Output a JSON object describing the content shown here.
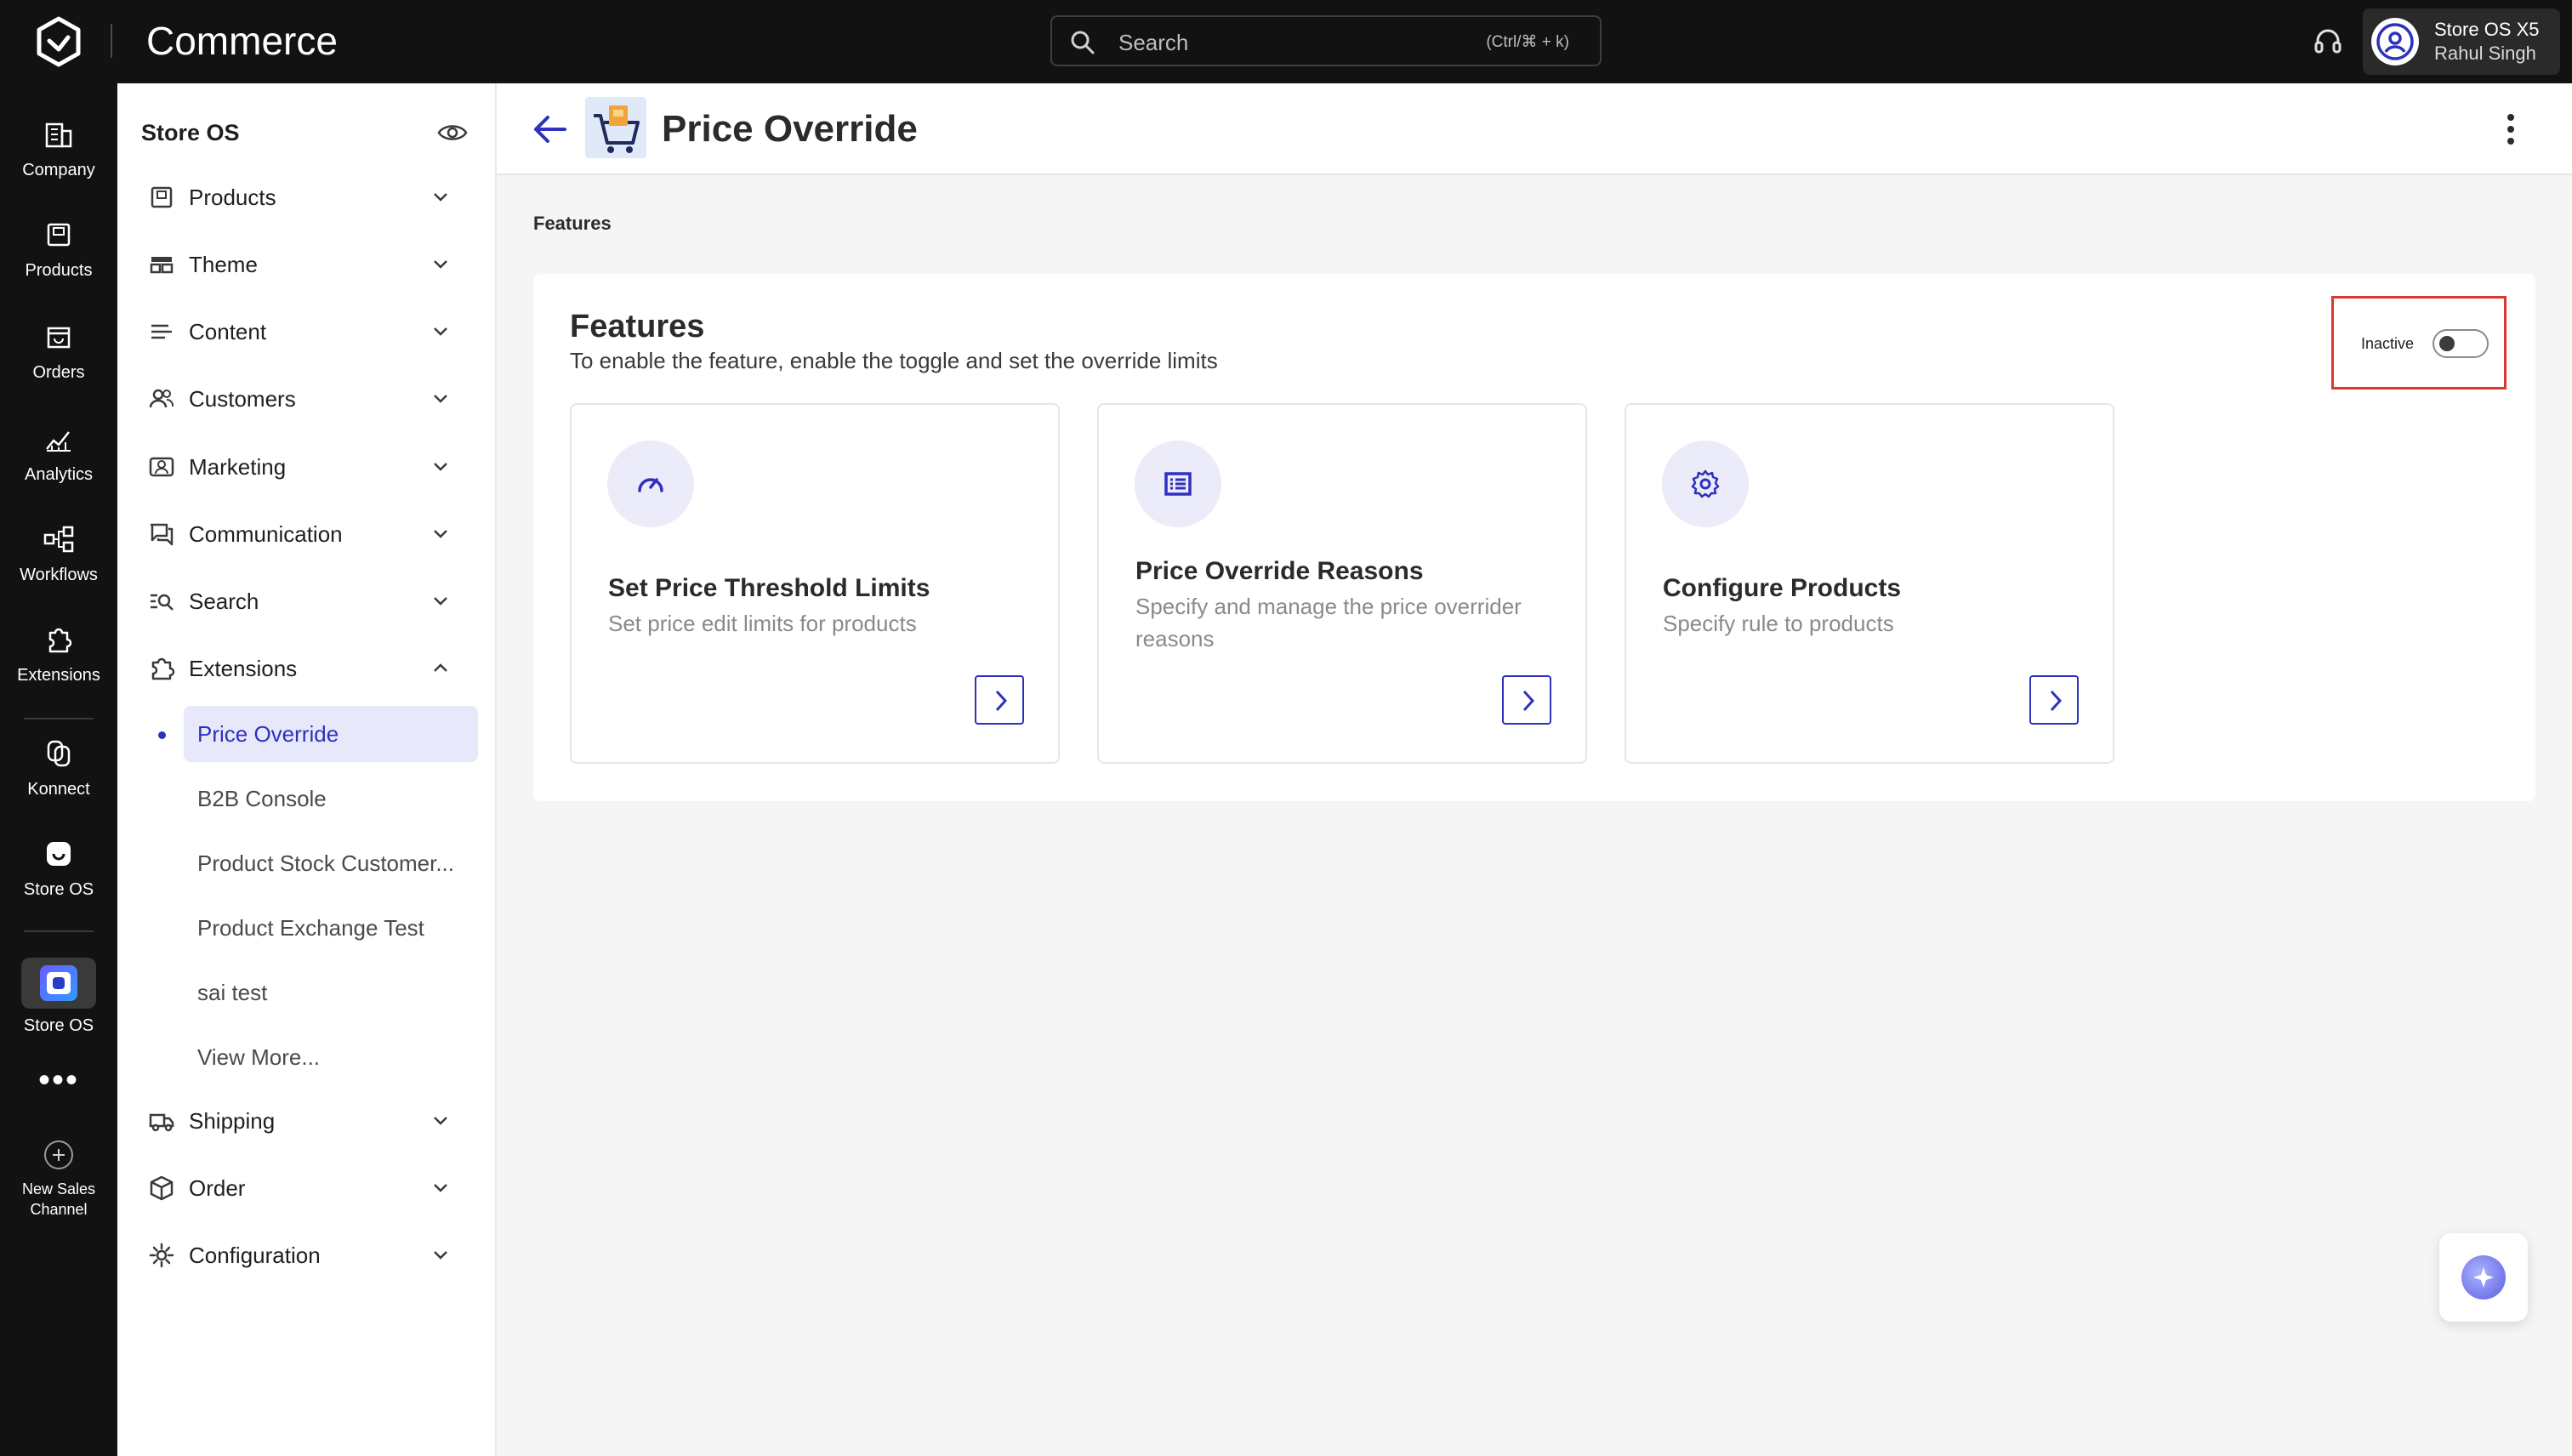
{
  "topbar": {
    "app_title": "Commerce",
    "search_placeholder": "Search",
    "search_shortcut": "(Ctrl/⌘ + k)",
    "user_store": "Store OS X5",
    "user_name": "Rahul Singh"
  },
  "rail": {
    "items": [
      {
        "label": "Company",
        "icon": "company-icon"
      },
      {
        "label": "Products",
        "icon": "products-icon"
      },
      {
        "label": "Orders",
        "icon": "orders-icon"
      },
      {
        "label": "Analytics",
        "icon": "analytics-icon"
      },
      {
        "label": "Workflows",
        "icon": "workflows-icon"
      },
      {
        "label": "Extensions",
        "icon": "extensions-icon"
      },
      {
        "label": "Konnect",
        "icon": "konnect-icon"
      },
      {
        "label": "Store OS",
        "icon": "storeos-icon"
      }
    ],
    "active_app_label": "Store OS",
    "more": "•••",
    "new_channel_line1": "New Sales",
    "new_channel_line2": "Channel"
  },
  "sidemenu": {
    "header": "Store OS",
    "items": [
      {
        "label": "Products",
        "icon": "products-box-icon"
      },
      {
        "label": "Theme",
        "icon": "theme-icon"
      },
      {
        "label": "Content",
        "icon": "content-icon"
      },
      {
        "label": "Customers",
        "icon": "customers-icon"
      },
      {
        "label": "Marketing",
        "icon": "marketing-icon"
      },
      {
        "label": "Communication",
        "icon": "communication-icon"
      },
      {
        "label": "Search",
        "icon": "search-list-icon"
      },
      {
        "label": "Extensions",
        "icon": "puzzle-icon"
      }
    ],
    "extensions_sub": [
      "Price Override",
      "B2B Console",
      "Product Stock Customer...",
      "Product Exchange Test",
      "sai test",
      "View More..."
    ],
    "bottom_items": [
      {
        "label": "Shipping",
        "icon": "truck-icon"
      },
      {
        "label": "Order",
        "icon": "cube-icon"
      },
      {
        "label": "Configuration",
        "icon": "gear-icon"
      }
    ]
  },
  "main": {
    "title": "Price Override",
    "breadcrumb": "Features",
    "features": {
      "title": "Features",
      "subtitle": "To enable the feature, enable the toggle and set the override limits",
      "toggle_label": "Inactive",
      "toggle_on": false,
      "cards": [
        {
          "title": "Set Price Threshold Limits",
          "desc": "Set price edit limits for products",
          "icon": "gauge-icon"
        },
        {
          "title": "Price Override Reasons",
          "desc": "Specify and manage the price overrider reasons",
          "icon": "list-icon"
        },
        {
          "title": "Configure Products",
          "desc": "Specify rule to products",
          "icon": "gear-icon"
        }
      ]
    }
  },
  "colors": {
    "accent": "#2e31be",
    "topbar_bg": "#121212",
    "highlight_border": "#d93a2b",
    "active_sub_bg": "#e8e8fb"
  }
}
